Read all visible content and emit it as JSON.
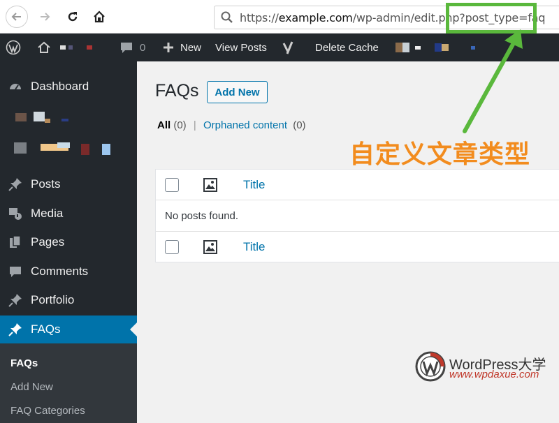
{
  "browser": {
    "url_prefix": "https://",
    "url_domain": "example.com",
    "url_path": "/wp-admin/edit.php?post_type=faq"
  },
  "admin_bar": {
    "comments_count": "0",
    "new_label": "New",
    "view_posts_label": "View Posts",
    "delete_cache_label": "Delete Cache"
  },
  "sidebar": {
    "dashboard": "Dashboard",
    "posts": "Posts",
    "media": "Media",
    "pages": "Pages",
    "comments": "Comments",
    "portfolio": "Portfolio",
    "faqs": "FAQs",
    "submenu": {
      "faqs": "FAQs",
      "add_new": "Add New",
      "faq_categories": "FAQ Categories"
    }
  },
  "main": {
    "title": "FAQs",
    "add_new_label": "Add New",
    "views": {
      "all_label": "All",
      "all_count": "(0)",
      "orphaned_label": "Orphaned content",
      "orphaned_count": "(0)"
    },
    "table": {
      "title_header": "Title",
      "title_footer": "Title",
      "empty_message": "No posts found."
    }
  },
  "annotation": {
    "text": "自定义文章类型",
    "color": "#f28c1e",
    "highlight_color": "#5ab83c"
  },
  "watermark": {
    "name": "WordPress大学",
    "url": "www.wpdaxue.com"
  },
  "colors": {
    "admin_dark": "#23282d",
    "wp_blue": "#0073aa"
  }
}
